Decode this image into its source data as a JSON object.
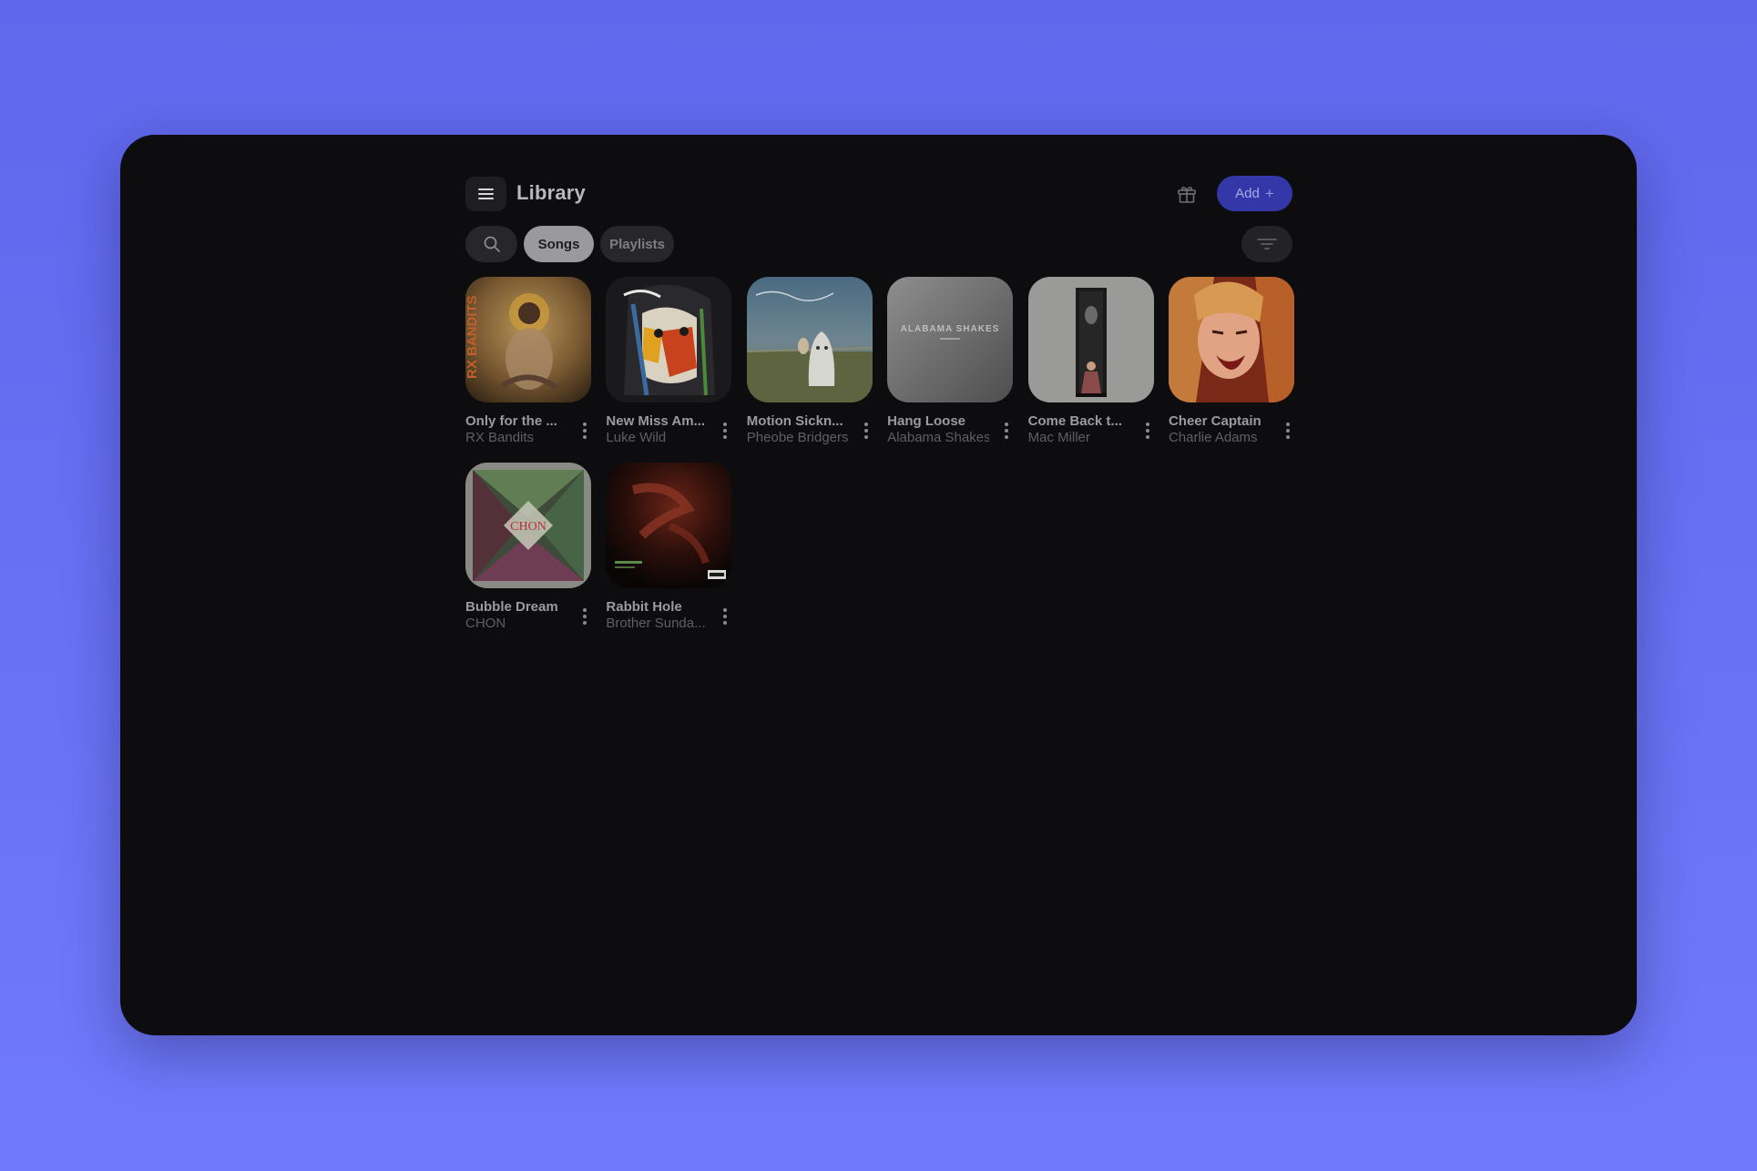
{
  "header": {
    "title": "Library",
    "add_label": "Add",
    "add_plus": "+",
    "menu_icon": "hamburger-icon",
    "gift_icon": "gift-icon"
  },
  "filters": {
    "search_icon": "search-icon",
    "chips": [
      {
        "label": "Songs",
        "selected": true
      },
      {
        "label": "Playlists",
        "selected": false
      }
    ],
    "sort_icon": "sort-icon"
  },
  "songs": [
    {
      "title": "Only for the ...",
      "artist": "RX Bandits"
    },
    {
      "title": "New Miss Am...",
      "artist": "Luke Wild"
    },
    {
      "title": "Motion Sickn...",
      "artist": "Pheobe Bridgers"
    },
    {
      "title": "Hang Loose",
      "artist": "Alabama Shakes"
    },
    {
      "title": "Come Back t...",
      "artist": "Mac Miller"
    },
    {
      "title": "Cheer Captain",
      "artist": "Charlie Adams"
    },
    {
      "title": "Bubble Dream",
      "artist": "CHON"
    },
    {
      "title": "Rabbit Hole",
      "artist": "Brother Sunda..."
    }
  ],
  "art_text": {
    "rx": "RX BANDITS",
    "alabama": "ALABAMA SHAKES",
    "chon": "CHON"
  },
  "colors": {
    "accent": "#3337a8",
    "background": "#0d0d10",
    "page_gradient_top": "#5f67ec",
    "page_gradient_bottom": "#7079fb"
  }
}
